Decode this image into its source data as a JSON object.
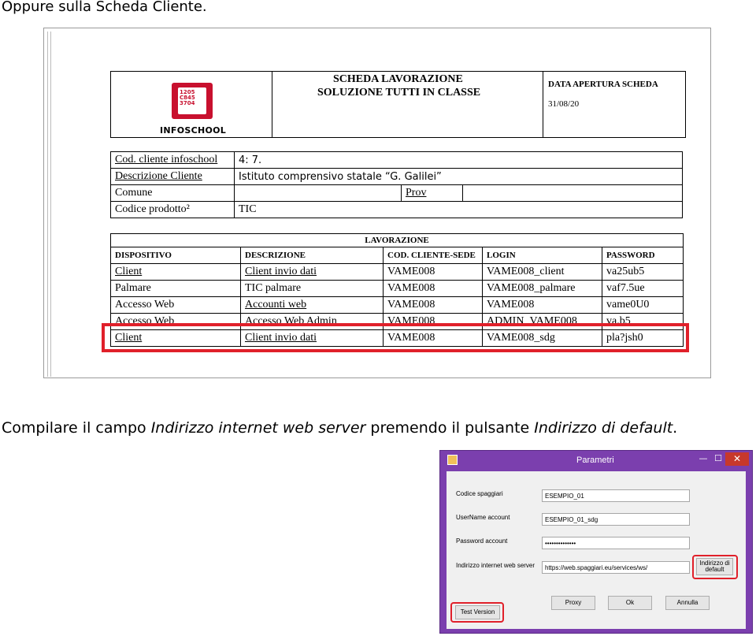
{
  "captions": {
    "top": "Oppure sulla Scheda Cliente.",
    "mid_prefix": "Compilare il campo ",
    "mid_field": "Indirizzo internet web server",
    "mid_middle": " premendo il pulsante ",
    "mid_button": "Indirizzo di default",
    "mid_suffix": "."
  },
  "doc": {
    "logo_text": "1205\nC845\n3704",
    "logo_name": "INFOSCHOOL",
    "title1": "SCHEDA LAVORAZIONE",
    "title2": "SOLUZIONE TUTTI IN CLASSE",
    "date_label": "DATA APERTURA SCHEDA",
    "date_value": "31/08/20",
    "info": {
      "code_label": "Cod. cliente infoschool",
      "code_value": "4: 7.",
      "desc_label": "Descrizione Cliente",
      "desc_value": "Istituto comprensivo statale “G. Galilei”",
      "comune_label": "Comune",
      "comune_value": "",
      "prov_label": "Prov",
      "prov_value": "",
      "product_label": "Codice prodotto²",
      "product_value": "TIC"
    },
    "lavorazione": {
      "title": "LAVORAZIONE",
      "headers": [
        "DISPOSITIVO",
        "DESCRIZIONE",
        "COD. CLIENTE-SEDE",
        "LOGIN",
        "PASSWORD"
      ],
      "rows": [
        [
          "Client",
          "Client invio dati",
          "VAME008",
          "VAME008_client",
          "va25ub5"
        ],
        [
          "Palmare",
          "TIC palmare",
          "VAME008",
          "VAME008_palmare",
          "vaf7.5ue"
        ],
        [
          "Accesso Web",
          "Accounti web",
          "VAME008",
          "VAME008",
          "vame0U0"
        ],
        [
          "Accesso Web",
          "Accesso Web Admin",
          "VAME008",
          "ADMIN_VAME008",
          "va.b5"
        ],
        [
          "Client",
          "Client invio dati",
          "VAME008",
          "VAME008_sdg",
          "pla?jsh0"
        ]
      ]
    }
  },
  "dialog": {
    "title": "Parametri",
    "min_glyph": "—",
    "max_glyph": "☐",
    "close_glyph": "✕",
    "fields": [
      {
        "label": "Codice spaggiari",
        "value": "ESEMPIO_01"
      },
      {
        "label": "UserName account",
        "value": "ESEMPIO_01_sdg"
      },
      {
        "label": "Password account",
        "value": "••••••••••••••"
      },
      {
        "label": "Indirizzo internet web server",
        "value": "https://web.spaggiari.eu/services/ws/"
      }
    ],
    "default_button": "Indirizzo di default",
    "test_button": "Test Version",
    "proxy_button": "Proxy",
    "ok_button": "Ok",
    "cancel_button": "Annulla",
    "colors": {
      "frame": "#7b3fae",
      "close": "#c7382c",
      "highlight": "#e0202a"
    }
  }
}
